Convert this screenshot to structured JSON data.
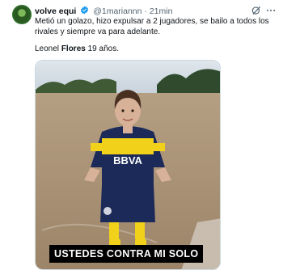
{
  "tweet": {
    "display_name": "volve equi",
    "handle": "@1mariannn",
    "separator": "·",
    "time": "21min",
    "text": "Metió un golazo, hizo expulsar a 2 jugadores, se bailo a todos los rivales y siempre va para adelante.",
    "line2_prefix": "Leonel ",
    "line2_bold": "Flores",
    "line2_suffix": " 19 años.",
    "media": {
      "caption": "USTEDES CONTRA MI SOLO",
      "jersey_text": "BBVA"
    },
    "colors": {
      "verified": "#1d9bf0",
      "jersey_blue": "#1c2a5a",
      "jersey_yellow": "#f2d11b"
    }
  }
}
